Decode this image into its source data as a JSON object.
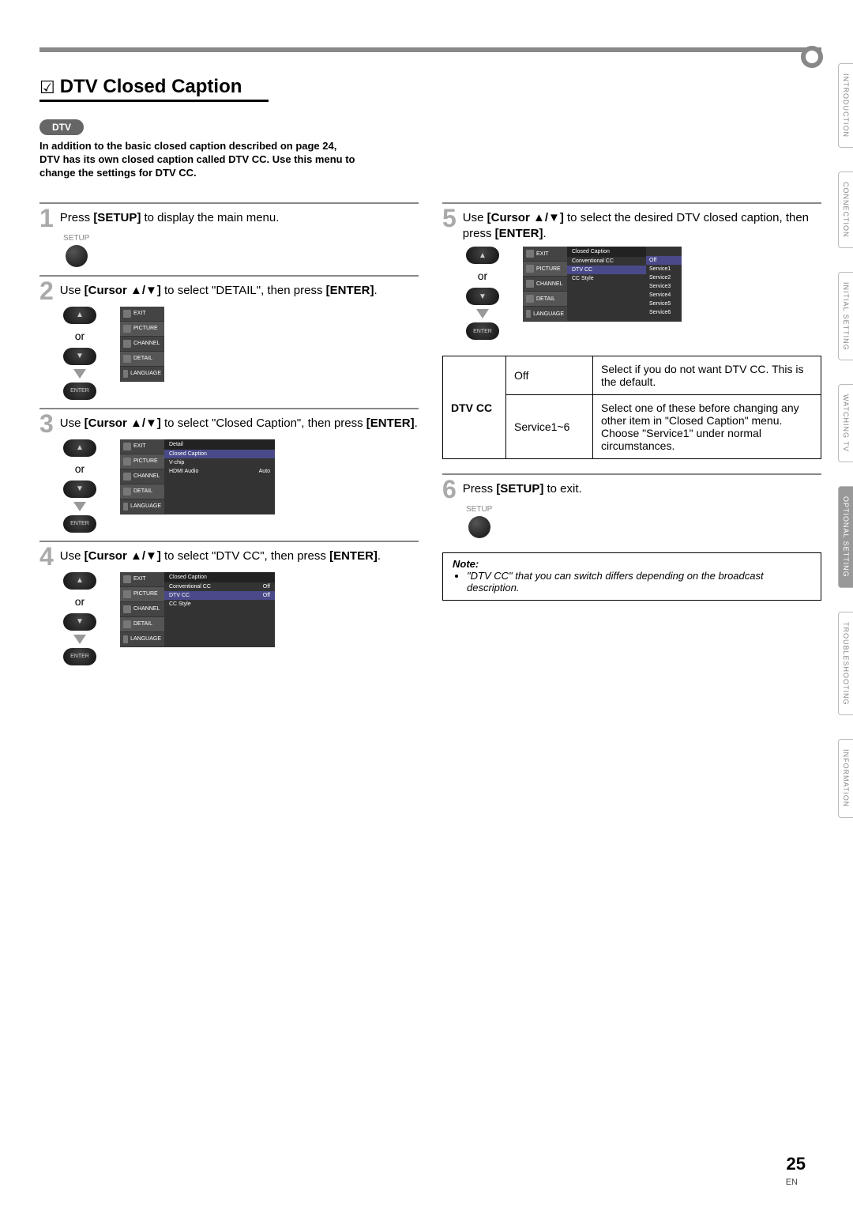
{
  "title": "DTV Closed Caption",
  "dtv_badge": "DTV",
  "intro": "In addition to the basic closed caption described on page 24, DTV has its own closed caption called DTV CC. Use this menu to change the settings for DTV CC.",
  "or_label": "or",
  "setup_label": "SETUP",
  "enter_label": "ENTER",
  "steps": {
    "s1": {
      "num": "1",
      "text_before": "Press ",
      "button": "[SETUP]",
      "text_after": " to display the main menu."
    },
    "s2": {
      "num": "2",
      "text_before": "Use ",
      "button": "[Cursor ▲/▼]",
      "text_after": " to select \"DETAIL\", then press ",
      "button2": "[ENTER]",
      "text_end": "."
    },
    "s3": {
      "num": "3",
      "text_before": "Use ",
      "button": "[Cursor ▲/▼]",
      "text_after": " to select \"Closed Caption\", then press ",
      "button2": "[ENTER]",
      "text_end": "."
    },
    "s4": {
      "num": "4",
      "text_before": "Use ",
      "button": "[Cursor ▲/▼]",
      "text_after": " to select \"DTV CC\", then press ",
      "button2": "[ENTER]",
      "text_end": "."
    },
    "s5": {
      "num": "5",
      "text_before": "Use ",
      "button": "[Cursor ▲/▼]",
      "text_after": " to select the desired DTV closed caption, then press ",
      "button2": "[ENTER]",
      "text_end": "."
    },
    "s6": {
      "num": "6",
      "text_before": "Press ",
      "button": "[SETUP]",
      "text_after": " to exit."
    }
  },
  "menu": {
    "sidebar": [
      "EXIT",
      "PICTURE",
      "CHANNEL",
      "DETAIL",
      "LANGUAGE"
    ],
    "detail_panel": {
      "title": "Detail",
      "rows": [
        {
          "label": "Closed Caption",
          "value": ""
        },
        {
          "label": "V-chip",
          "value": ""
        },
        {
          "label": "HDMI Audio",
          "value": "Auto"
        }
      ]
    },
    "cc_panel": {
      "title": "Closed Caption",
      "rows": [
        {
          "label": "Conventional CC",
          "value": "Off"
        },
        {
          "label": "DTV CC",
          "value": "Off"
        },
        {
          "label": "CC Style",
          "value": ""
        }
      ]
    },
    "dtvcc_panel": {
      "title": "Closed Caption",
      "rows": [
        {
          "label": "Conventional CC",
          "value": ""
        },
        {
          "label": "DTV CC",
          "value": ""
        },
        {
          "label": "CC Style",
          "value": ""
        }
      ],
      "options": [
        "Off",
        "Service1",
        "Service2",
        "Service3",
        "Service4",
        "Service5",
        "Service6"
      ]
    }
  },
  "table": {
    "row_label": "DTV CC",
    "r1": {
      "opt": "Off",
      "desc": "Select if you do not want DTV CC. This is the default."
    },
    "r2": {
      "opt": "Service1~6",
      "desc": "Select one of these before changing any other item in \"Closed Caption\" menu. Choose \"Service1\" under normal circumstances."
    }
  },
  "note": {
    "title": "Note:",
    "item": "\"DTV CC\" that you can switch differs depending on the broadcast description."
  },
  "side_tabs": [
    "INTRODUCTION",
    "CONNECTION",
    "INITIAL SETTING",
    "WATCHING TV",
    "OPTIONAL SETTING",
    "TROUBLESHOOTING",
    "INFORMATION"
  ],
  "active_tab_index": 4,
  "page_number": "25",
  "page_lang": "EN"
}
